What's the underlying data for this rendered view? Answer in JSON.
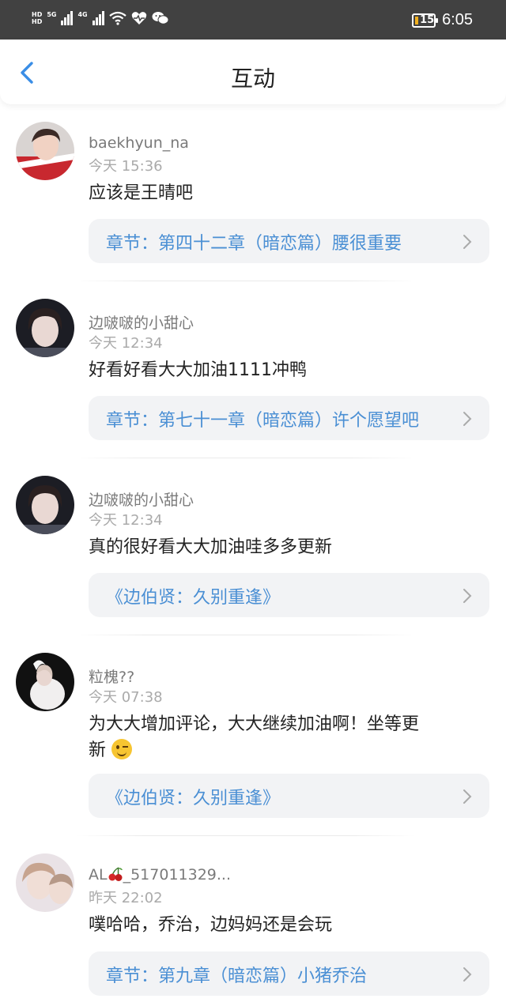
{
  "status_bar": {
    "net1_top": "HD",
    "net1_bottom": "HD",
    "net_5g": "5G",
    "net_4g": "4G",
    "battery": "15",
    "time": "6:05"
  },
  "header": {
    "title": "互动"
  },
  "comments": [
    {
      "user": "baekhyun_na",
      "time": "今天 15:36",
      "text": "应该是王晴吧",
      "ref": "章节：第四十二章（暗恋篇）腰很重要"
    },
    {
      "user": "边啵啵的小甜心",
      "time": "今天 12:34",
      "text": "好看好看大大加油1111冲鸭",
      "ref": "章节：第七十一章（暗恋篇）许个愿望吧"
    },
    {
      "user": "边啵啵的小甜心",
      "time": "今天 12:34",
      "text": "真的很好看大大加油哇多多更新",
      "ref": "《边伯贤：久别重逢》"
    },
    {
      "user": "粒槐??",
      "time": "今天 07:38",
      "text_line1": "为大大增加评论，大大继续加油啊！坐等更",
      "text_line2": "新",
      "ref": "《边伯贤：久别重逢》"
    },
    {
      "user_prefix": "AL",
      "user_suffix": "_517011329...",
      "time": "昨天 22:02",
      "text": "噗哈哈，乔治，边妈妈还是会玩",
      "ref": "章节：第九章（暗恋篇）小猪乔治"
    }
  ],
  "icons": {
    "back": "chevron-left-icon",
    "ref_arrow": "chevron-right-icon",
    "wink": "wink-emoji-icon",
    "cherry": "cherry-emoji-icon"
  },
  "colors": {
    "status_bar": "#414141",
    "accent": "#4a8fd4",
    "ref_bg": "#f2f3f5"
  }
}
